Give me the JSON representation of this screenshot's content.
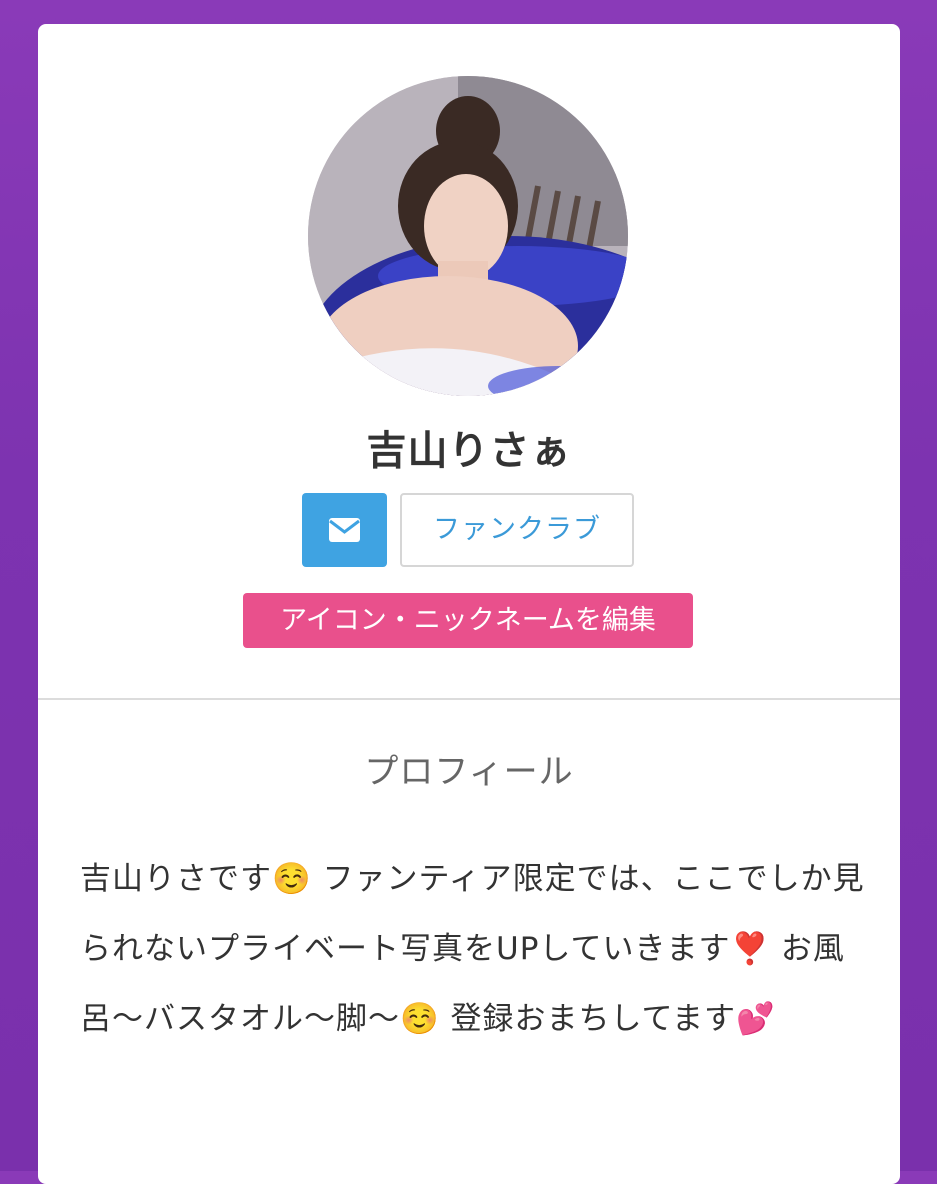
{
  "profile": {
    "name": "吉山りさぁ",
    "buttons": {
      "fanclub_label": "ファンクラブ",
      "edit_label": "アイコン・ニックネームを編集"
    },
    "icons": {
      "mail": "envelope-icon",
      "avatar": "profile-photo"
    }
  },
  "section": {
    "title": "プロフィール",
    "bio": "吉山りさです☺️ ファンティア限定では、ここでしか見られないプライベート写真をUPしていきます❣️ お風呂〜バスタオル〜脚〜☺️ 登録おまちしてます💕"
  },
  "colors": {
    "background": "#8a3ab8",
    "mail_button": "#3fa3e2",
    "fanclub_text": "#3b9ad8",
    "edit_button": "#e9508c"
  }
}
